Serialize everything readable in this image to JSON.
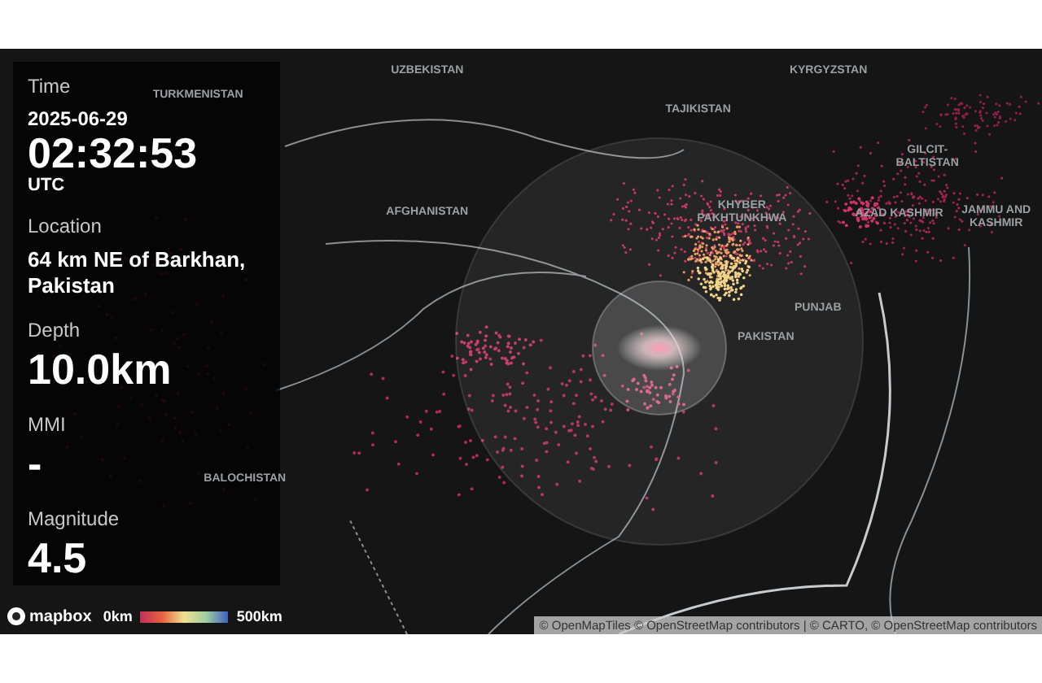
{
  "info_panel": {
    "fields": [
      {
        "kind": "time",
        "label": "Time",
        "date": "2025-06-29",
        "value": "02:32:53",
        "zone": "UTC"
      },
      {
        "kind": "text",
        "label": "Location",
        "value": "64 km NE of Barkhan, Pakistan"
      },
      {
        "kind": "big",
        "label": "Depth",
        "value": "10.0km"
      },
      {
        "kind": "big",
        "label": "MMI",
        "value": "-"
      },
      {
        "kind": "big",
        "label": "Magnitude",
        "value": "4.5"
      }
    ]
  },
  "map": {
    "labels": [
      {
        "text": "UZBEKISTAN"
      },
      {
        "text": "KYRGYZSTAN"
      },
      {
        "text": "TURKMENISTAN"
      },
      {
        "text": "TAJIKISTAN"
      },
      {
        "text": "GILCIT-BALTISTAN"
      },
      {
        "text": "AFGHANISTAN"
      },
      {
        "text": "KHYBER PAKHTUNKHWA"
      },
      {
        "text": "AZAD KASHMIR"
      },
      {
        "text": "JAMMU AND KASHMIR"
      },
      {
        "text": "PUNJAB"
      },
      {
        "text": "PAKISTAN"
      },
      {
        "text": "BALOCHISTAN"
      }
    ],
    "logo": "mapbox",
    "legend": {
      "min": "0km",
      "max": "500km"
    },
    "attribution": "© OpenMapTiles © OpenStreetMap contributors | © CARTO, © OpenStreetMap contributors"
  }
}
